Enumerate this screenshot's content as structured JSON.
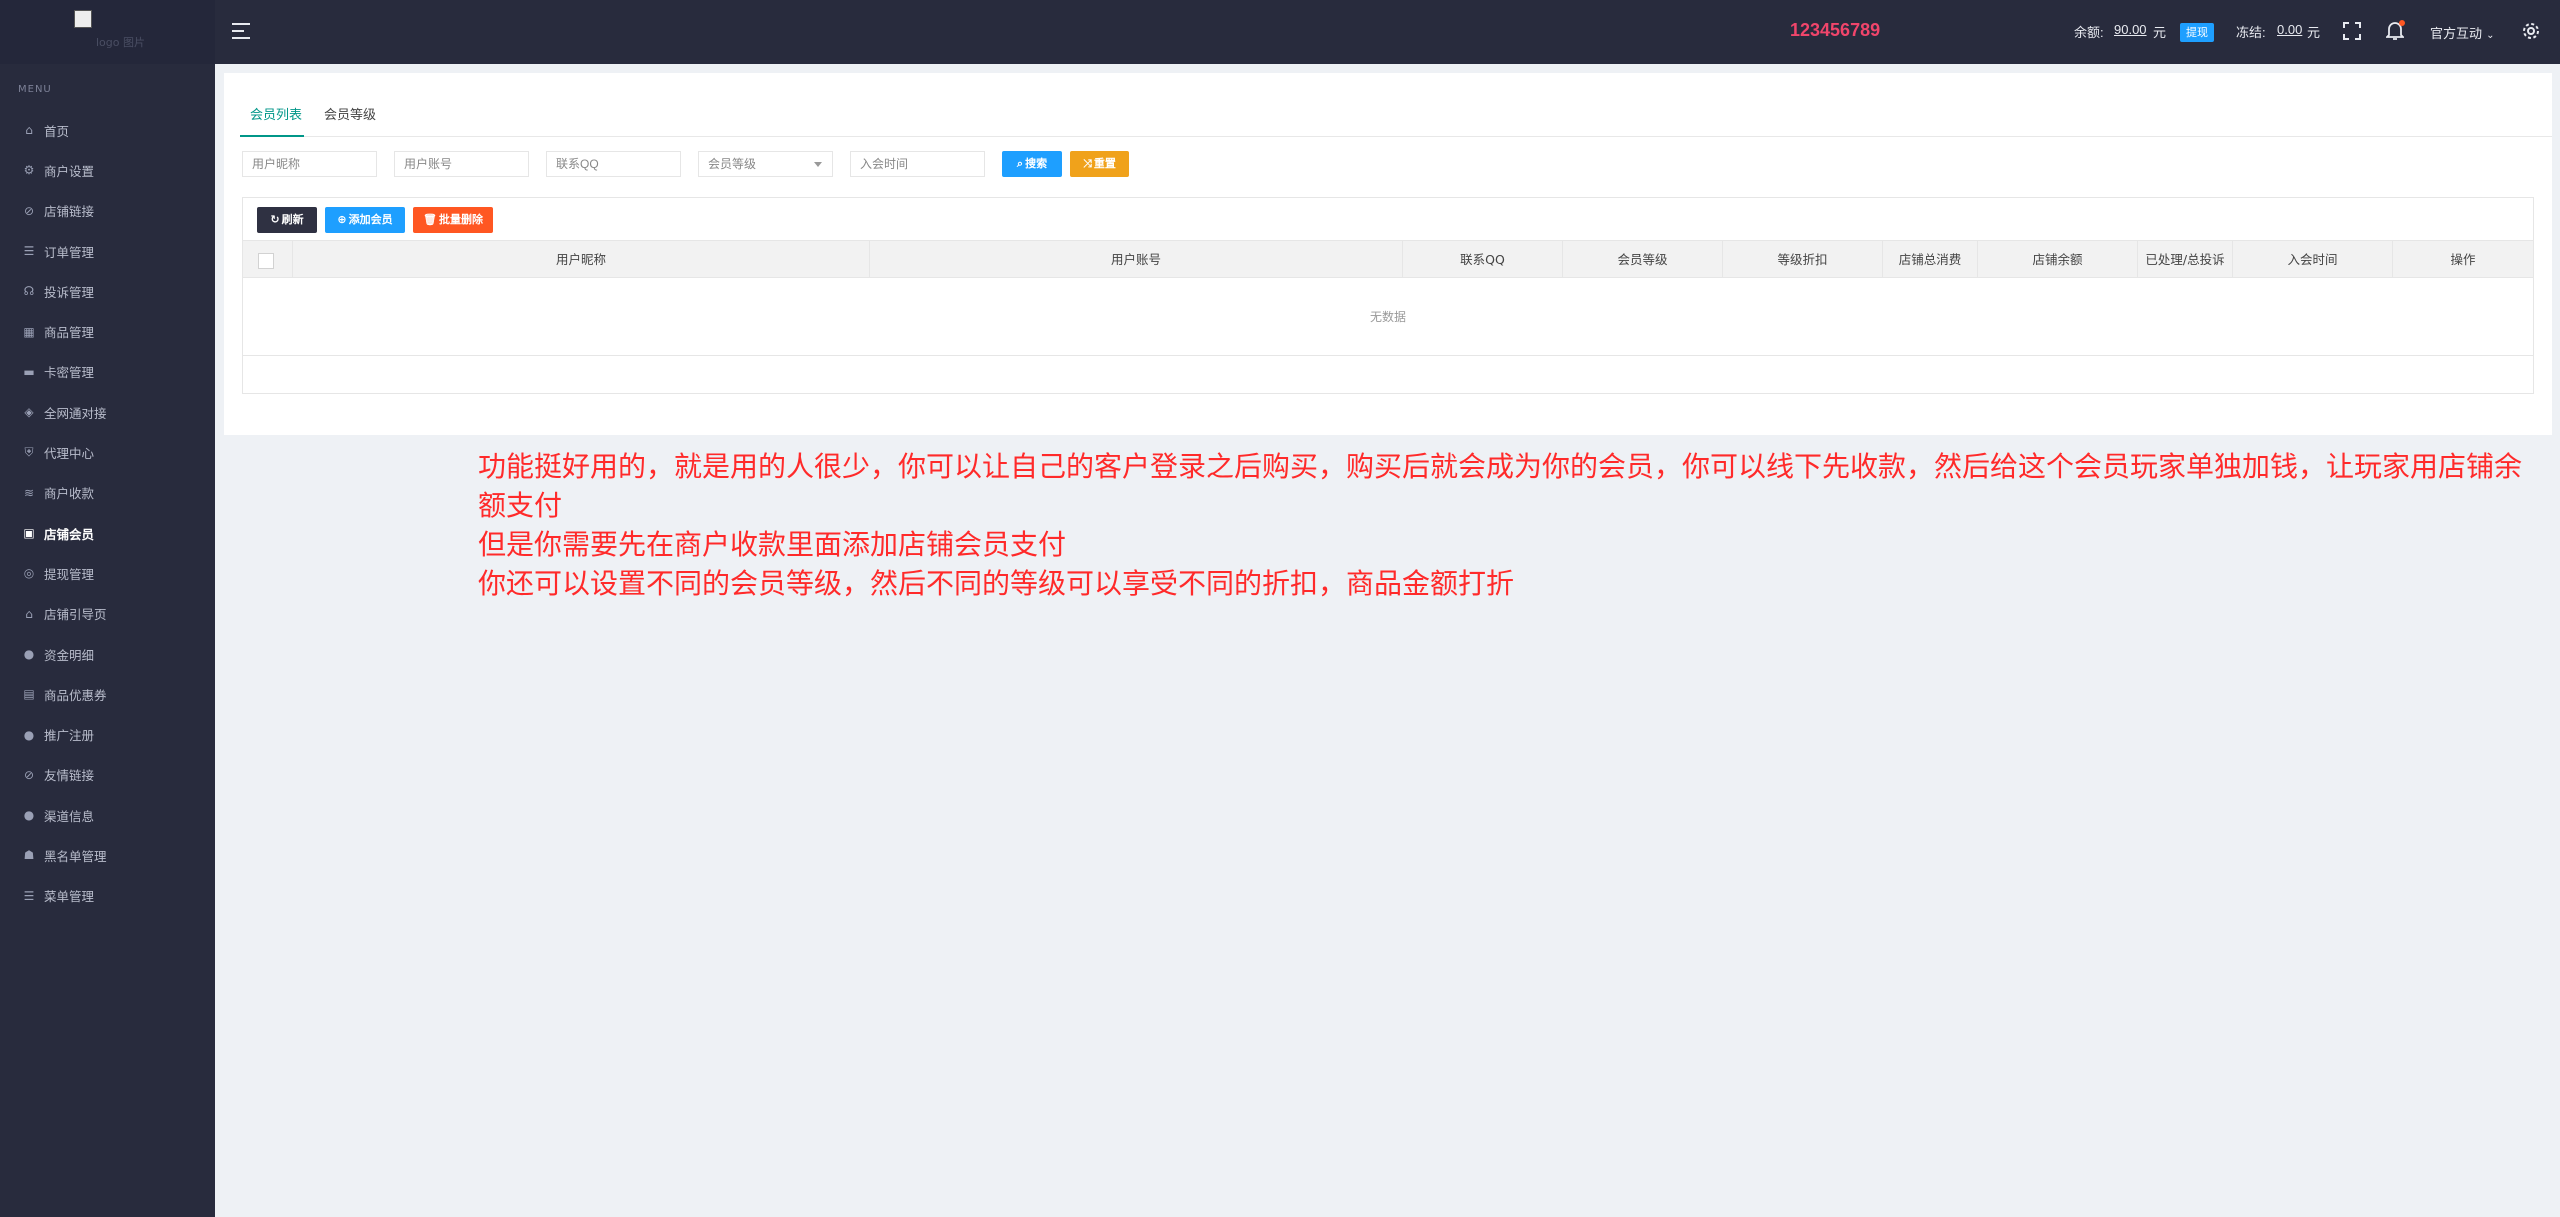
{
  "topbar": {
    "logo_alt": "logo 图片",
    "brand_number": "123456789",
    "balance_label": "余额:",
    "balance_value": "90.00",
    "balance_unit": "元",
    "withdraw_label": "提现",
    "frozen_label": "冻结:",
    "frozen_value": "0.00",
    "frozen_unit": "元",
    "user_name": "官方互动",
    "icons": [
      "menu-icon",
      "fullscreen-icon",
      "bell-icon",
      "gear-icon",
      "chevron-down-icon"
    ]
  },
  "sidebar": {
    "menu_label": "MENU",
    "items": [
      {
        "label": "首页",
        "icon": "⌂",
        "icon_name": "home-icon"
      },
      {
        "label": "商户设置",
        "icon": "⚙",
        "icon_name": "gear-icon"
      },
      {
        "label": "店铺链接",
        "icon": "⊘",
        "icon_name": "link-icon"
      },
      {
        "label": "订单管理",
        "icon": "☰",
        "icon_name": "list-icon"
      },
      {
        "label": "投诉管理",
        "icon": "☊",
        "icon_name": "headset-icon"
      },
      {
        "label": "商品管理",
        "icon": "▦",
        "icon_name": "grid-icon"
      },
      {
        "label": "卡密管理",
        "icon": "▬",
        "icon_name": "card-icon"
      },
      {
        "label": "全网通对接",
        "icon": "◈",
        "icon_name": "connect-icon"
      },
      {
        "label": "代理中心",
        "icon": "⛨",
        "icon_name": "shield-icon"
      },
      {
        "label": "商户收款",
        "icon": "≋",
        "icon_name": "chart-icon"
      },
      {
        "label": "店铺会员",
        "icon": "▣",
        "icon_name": "member-icon",
        "active": true
      },
      {
        "label": "提现管理",
        "icon": "◎",
        "icon_name": "withdraw-icon"
      },
      {
        "label": "店铺引导页",
        "icon": "⌂",
        "icon_name": "store-icon"
      },
      {
        "label": "资金明细",
        "icon": "●",
        "icon_name": "funds-icon"
      },
      {
        "label": "商品优惠券",
        "icon": "▤",
        "icon_name": "coupon-icon"
      },
      {
        "label": "推广注册",
        "icon": "●",
        "icon_name": "promote-icon"
      },
      {
        "label": "友情链接",
        "icon": "⊘",
        "icon_name": "link-icon"
      },
      {
        "label": "渠道信息",
        "icon": "●",
        "icon_name": "info-icon"
      },
      {
        "label": "黑名单管理",
        "icon": "☗",
        "icon_name": "blacklist-icon"
      },
      {
        "label": "菜单管理",
        "icon": "☰",
        "icon_name": "menu-manage-icon"
      }
    ]
  },
  "main": {
    "tabs": [
      {
        "label": "会员列表",
        "active": true
      },
      {
        "label": "会员等级",
        "active": false
      }
    ],
    "filters": {
      "nickname_placeholder": "用户昵称",
      "account_placeholder": "用户账号",
      "qq_placeholder": "联系QQ",
      "level_select": "会员等级",
      "join_time_placeholder": "入会时间"
    },
    "buttons": {
      "search": "搜索",
      "reset": "重置",
      "refresh": "刷新",
      "add_member": "添加会员",
      "batch_delete": "批量删除"
    },
    "table": {
      "columns": [
        "用户昵称",
        "用户账号",
        "联系QQ",
        "会员等级",
        "等级折扣",
        "店铺总消费",
        "店铺余额",
        "已处理/总投诉",
        "入会时间",
        "操作"
      ],
      "empty_text": "无数据"
    }
  },
  "annotation": {
    "lines": [
      "功能挺好用的，就是用的人很少，你可以让自己的客户登录之后购买，购买后就会成为你的会员，你可以线下先收款，然后给这个会员玩家单独加钱，让玩家用店铺余额支付",
      "但是你需要先在商户收款里面添加店铺会员支付",
      "你还可以设置不同的会员等级，然后不同的等级可以享受不同的折扣，商品金额打折"
    ]
  },
  "colors": {
    "topbar_bg": "#282b3d",
    "accent_teal": "#009688",
    "search_blue": "#1e9fff",
    "reset_orange": "#f0a21b",
    "delete_red": "#ff5722",
    "brand_pink": "#f0456b",
    "annotation_red": "#ff2a2a"
  }
}
